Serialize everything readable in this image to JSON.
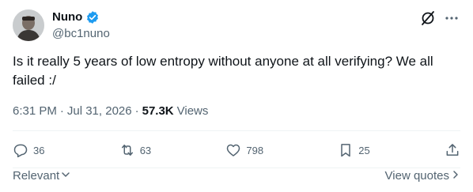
{
  "author": {
    "name": "Nuno",
    "handle": "@bc1nuno"
  },
  "tweet": {
    "text": "Is it really 5 years of low entropy without anyone at all verifying? We all failed :/",
    "time": "6:31 PM",
    "separator": "·",
    "date": "Jul 31, 2026",
    "views_count": "57.3K",
    "views_label": "Views"
  },
  "actions": {
    "replies": "36",
    "reposts": "63",
    "likes": "798",
    "bookmarks": "25"
  },
  "footer": {
    "sort_label": "Relevant",
    "quotes_label": "View quotes"
  },
  "icons": {
    "verified": "verified-badge-icon",
    "grok": "grok-icon",
    "more": "more-icon",
    "reply": "reply-icon",
    "repost": "repost-icon",
    "like": "heart-icon",
    "bookmark": "bookmark-icon",
    "share": "share-icon"
  },
  "colors": {
    "verified_blue": "#1d9bf0",
    "text_primary": "#0f1419",
    "text_secondary": "#536471"
  }
}
